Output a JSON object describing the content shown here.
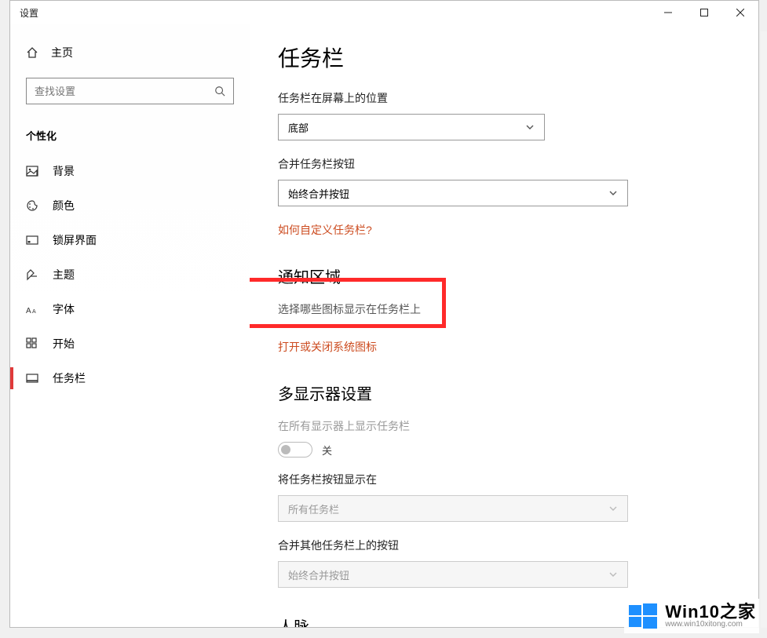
{
  "window": {
    "title": "设置"
  },
  "sidebar": {
    "home_label": "主页",
    "search_placeholder": "查找设置",
    "section": "个性化",
    "items": [
      {
        "label": "背景"
      },
      {
        "label": "颜色"
      },
      {
        "label": "锁屏界面"
      },
      {
        "label": "主题"
      },
      {
        "label": "字体"
      },
      {
        "label": "开始"
      },
      {
        "label": "任务栏"
      }
    ]
  },
  "main": {
    "title": "任务栏",
    "position_label": "任务栏在屏幕上的位置",
    "position_value": "底部",
    "combine_label": "合并任务栏按钮",
    "combine_value": "始终合并按钮",
    "customize_link": "如何自定义任务栏?",
    "notification_heading": "通知区域",
    "select_icons_link": "选择哪些图标显示在任务栏上",
    "system_icons_link": "打开或关闭系统图标",
    "multi_heading": "多显示器设置",
    "show_all_label": "在所有显示器上显示任务栏",
    "toggle_state_text": "关",
    "show_buttons_label": "将任务栏按钮显示在",
    "show_buttons_value": "所有任务栏",
    "combine_other_label": "合并其他任务栏上的按钮",
    "combine_other_value": "始终合并按钮",
    "people_heading": "人脉"
  },
  "watermark": {
    "text": "Win10之家",
    "url": "www.win10xitong.com"
  }
}
